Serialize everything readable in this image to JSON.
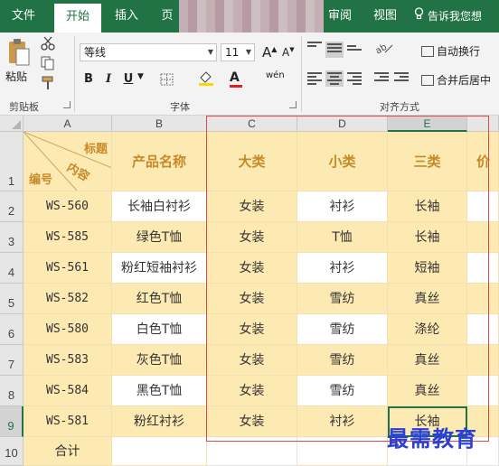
{
  "tabs": [
    {
      "label": "文件",
      "active": false
    },
    {
      "label": "开始",
      "active": true
    },
    {
      "label": "插入",
      "active": false
    },
    {
      "label": "页",
      "active": false
    },
    {
      "label": "审阅",
      "active": false
    },
    {
      "label": "视图",
      "active": false
    }
  ],
  "search_hint": "告诉我您想",
  "ribbon": {
    "paste_label": "粘贴",
    "clipboard_group": "剪贴板",
    "font_group": "字体",
    "align_group": "对齐方式",
    "font_name": "等线",
    "font_size": "11",
    "grow_font": "A",
    "shrink_font": "A",
    "bold": "B",
    "italic": "I",
    "underline": "U",
    "font_color_glyph": "A",
    "highlight_glyph": "ab",
    "phonetic_glyph": "wén",
    "wrap_text": "自动换行",
    "merge_center": "合并后居中"
  },
  "columns": [
    "A",
    "B",
    "C",
    "D",
    "E"
  ],
  "rows": [
    "1",
    "2",
    "3",
    "4",
    "5",
    "6",
    "7",
    "8",
    "9",
    "10"
  ],
  "header": {
    "a_top": "标题",
    "a_mid": "内容",
    "a_bottom": "编号",
    "b": "产品名称",
    "c": "大类",
    "d": "小类",
    "e": "三类",
    "f": "价"
  },
  "data_rows": [
    {
      "code": "WS-560",
      "name": "长袖白衬衫",
      "cat": "女装",
      "sub": "衬衫",
      "third": "长袖"
    },
    {
      "code": "WS-585",
      "name": "绿色T恤",
      "cat": "女装",
      "sub": "T恤",
      "third": "长袖"
    },
    {
      "code": "WS-561",
      "name": "粉红短袖衬衫",
      "cat": "女装",
      "sub": "衬衫",
      "third": "短袖"
    },
    {
      "code": "WS-582",
      "name": "红色T恤",
      "cat": "女装",
      "sub": "雪纺",
      "third": "真丝"
    },
    {
      "code": "WS-580",
      "name": "白色T恤",
      "cat": "女装",
      "sub": "雪纺",
      "third": "涤纶"
    },
    {
      "code": "WS-583",
      "name": "灰色T恤",
      "cat": "女装",
      "sub": "雪纺",
      "third": "真丝"
    },
    {
      "code": "WS-584",
      "name": "黑色T恤",
      "cat": "女装",
      "sub": "雪纺",
      "third": "真丝"
    },
    {
      "code": "WS-581",
      "name": "粉红衬衫",
      "cat": "女装",
      "sub": "衬衫",
      "third": "长袖"
    }
  ],
  "total_label": "合计",
  "watermark": "最需教育",
  "colors": {
    "ribbon_green": "#217346",
    "cell_fill": "#fdeab2",
    "header_text": "#c78a2a",
    "annotation_red": "#d94a4a",
    "watermark_blue": "#2b3fd8"
  }
}
